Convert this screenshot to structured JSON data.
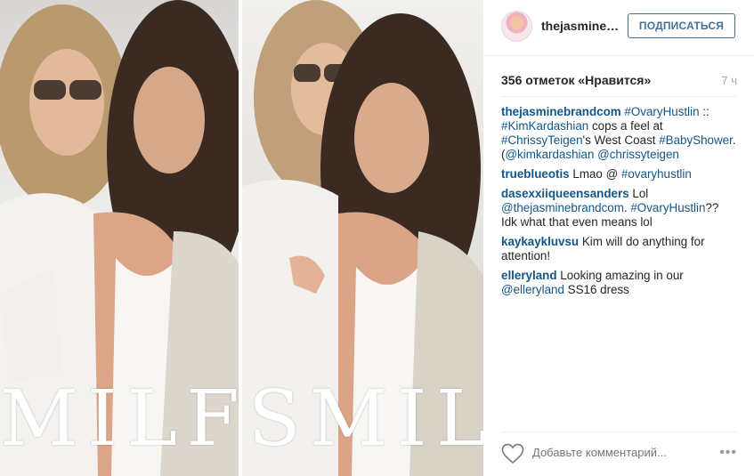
{
  "photo": {
    "overlay_text": "MILFSMILFS"
  },
  "header": {
    "username": "thejasmine…",
    "follow_label": "ПОДПИСАТЬСЯ"
  },
  "stats": {
    "likes": "356 отметок «Нравится»",
    "time": "7 ч"
  },
  "comments": [
    {
      "user": "thejasminebrandcom",
      "parts": [
        "#OvaryHustlin",
        " :: ",
        "#KimKardashian",
        " cops a feel at ",
        "#ChrissyTeigen",
        "'s West Coast ",
        "#BabyShower",
        ". (",
        "@kimkardashian",
        " ",
        "@chrissyteigen"
      ]
    },
    {
      "user": "trueblueotis",
      "parts": [
        "Lmao @ ",
        "#ovaryhustlin"
      ]
    },
    {
      "user": "dasexxiiqueensanders",
      "parts": [
        "Lol ",
        "@thejasminebrandcom",
        ". ",
        "#OvaryHustlin",
        "?? Idk what that even means lol"
      ]
    },
    {
      "user": "kaykaykluvsu",
      "parts": [
        "Kim will do anything for attention!"
      ]
    },
    {
      "user": "elleryland",
      "parts": [
        "Looking amazing in our ",
        "@elleryland",
        " SS16 dress"
      ]
    }
  ],
  "footer": {
    "add_comment_placeholder": "Добавьте комментарий...",
    "more_icon": "•••"
  },
  "colors": {
    "link": "#125688",
    "follow": "#3f729b",
    "muted": "#a5a7aa"
  }
}
